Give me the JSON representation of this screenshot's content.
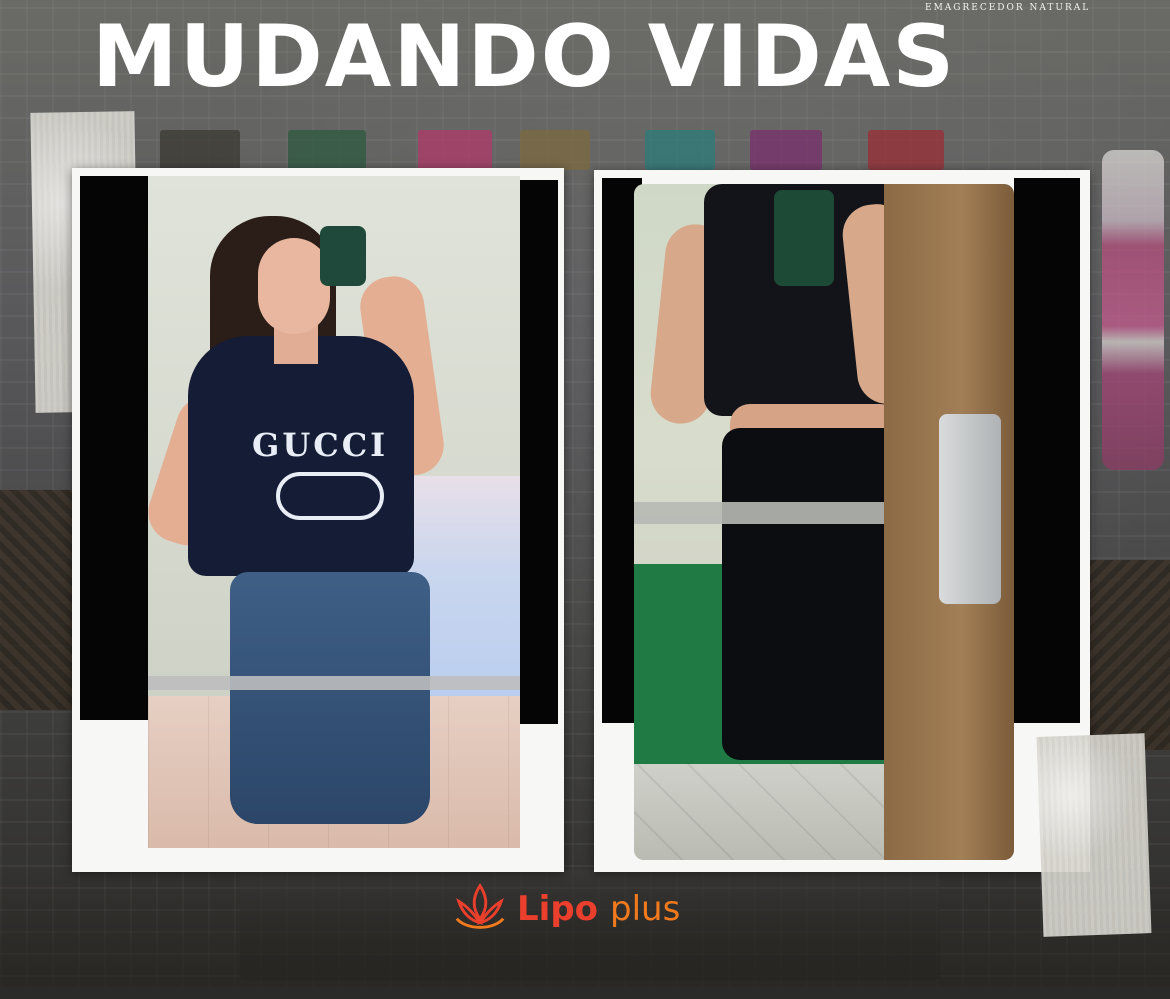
{
  "header": {
    "title": "MUDANDO VIDAS",
    "tagline": "EMAGRECEDOR NATURAL"
  },
  "photos": {
    "before": {
      "shirt_text": "GUCCI"
    }
  },
  "brand": {
    "name_part1": "Lipo",
    "name_part2": "plus",
    "icon": "lotus-flame-icon",
    "colors": {
      "primary": "#ea3f2c",
      "secondary": "#f07a1d"
    }
  }
}
